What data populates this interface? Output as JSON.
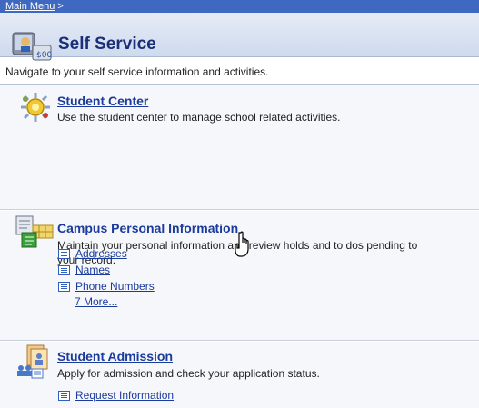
{
  "breadcrumb": {
    "main_menu": "Main Menu",
    "separator": ">"
  },
  "header": {
    "title": "Self Service",
    "icon": "self-service-icon"
  },
  "intro": "Navigate to your self service information and activities.",
  "sections": [
    {
      "title": "Student Center",
      "description": "Use the student center to manage school related activities.",
      "icon": "student-center-icon"
    },
    {
      "title": "Campus Personal Information",
      "description_line1": "Maintain your personal information and review holds and to dos pending to",
      "description_line2": "your record.",
      "icon": "campus-personal-info-icon",
      "links": [
        "Addresses",
        "Names",
        "Phone Numbers"
      ],
      "more": "7 More..."
    },
    {
      "title": "Student Admission",
      "description": "Apply for admission and check your application status.",
      "icon": "student-admission-icon",
      "links": [
        "Request Information"
      ]
    }
  ]
}
